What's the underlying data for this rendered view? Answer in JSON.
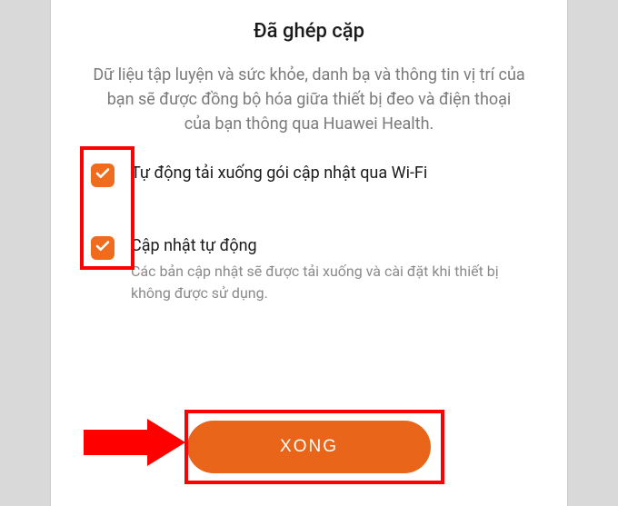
{
  "title": "Đã ghép cặp",
  "description": "Dữ liệu tập luyện và sức khỏe, danh bạ và thông tin vị trí của bạn sẽ được đồng bộ hóa giữa thiết bị đeo và điện thoại của bạn thông qua Huawei Health.",
  "options": {
    "wifi_download": {
      "label": "Tự động tải xuống gói cập nhật qua Wi-Fi",
      "checked": true
    },
    "auto_update": {
      "label": "Cập nhật tự động",
      "sublabel": "Các bản cập nhật sẽ được tải xuống và cài đặt khi thiết bị không được sử dụng.",
      "checked": true
    }
  },
  "done_button": "XONG",
  "colors": {
    "accent": "#e8651a",
    "highlight": "#ff0000"
  }
}
